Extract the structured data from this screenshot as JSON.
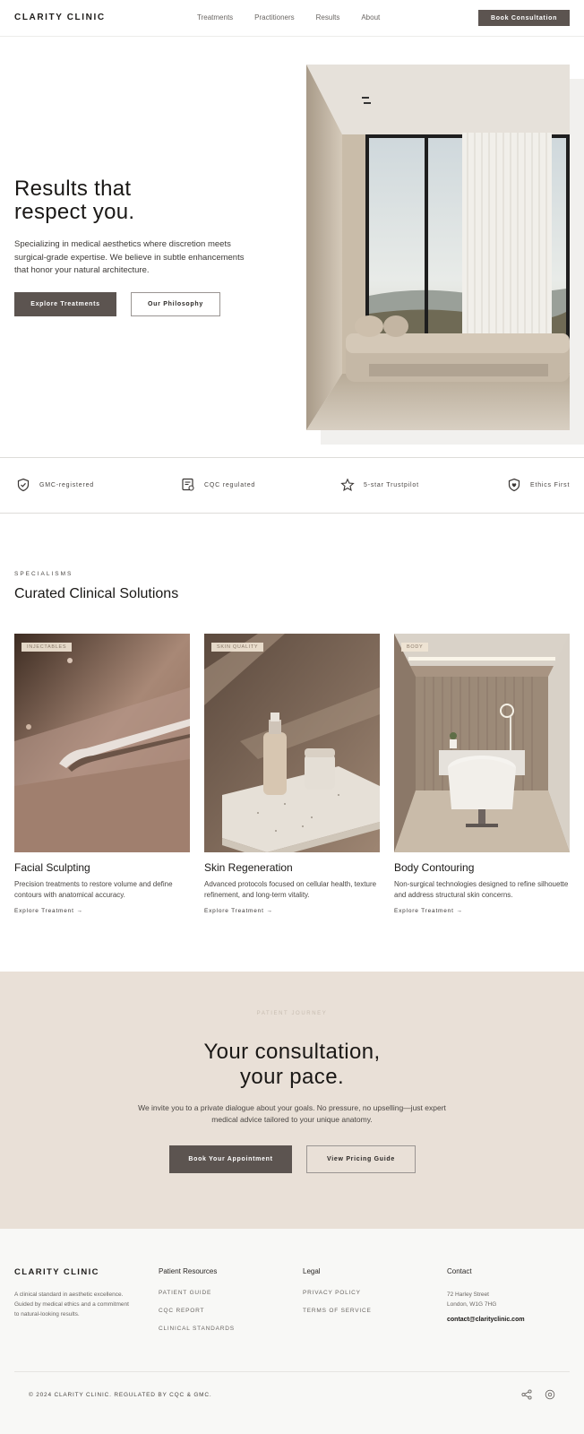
{
  "header": {
    "logo": "CLARITY CLINIC",
    "nav": [
      "Treatments",
      "Practitioners",
      "Results",
      "About"
    ],
    "cta": "Book Consultation"
  },
  "hero": {
    "title_line1": "Results that",
    "title_line2": "respect you.",
    "text": "Specializing in medical aesthetics where discretion meets surgical-grade expertise. We believe in subtle enhancements that honor your natural architecture.",
    "primary_button": "Explore Treatments",
    "secondary_button": "Our Philosophy"
  },
  "trust": {
    "items": [
      {
        "icon": "shield-check-icon",
        "label": "GMC-registered"
      },
      {
        "icon": "certificate-icon",
        "label": "CQC regulated"
      },
      {
        "icon": "star-icon",
        "label": "5-star Trustpilot"
      },
      {
        "icon": "shield-heart-icon",
        "label": "Ethics First"
      }
    ]
  },
  "specialisms": {
    "eyebrow": "SPECIALISMS",
    "title": "Curated Clinical Solutions",
    "cards": [
      {
        "tag": "INJECTABLES",
        "title": "Facial Sculpting",
        "text": "Precision treatments to restore volume and define contours with anatomical accuracy.",
        "link": "Explore Treatment"
      },
      {
        "tag": "SKIN QUALITY",
        "title": "Skin Regeneration",
        "text": "Advanced protocols focused on cellular health, texture refinement, and long-term vitality.",
        "link": "Explore Treatment"
      },
      {
        "tag": "BODY",
        "title": "Body Contouring",
        "text": "Non-surgical technologies designed to refine silhouette and address structural skin concerns.",
        "link": "Explore Treatment"
      }
    ]
  },
  "consultation": {
    "eyebrow": "PATIENT JOURNEY",
    "title_line1": "Your consultation,",
    "title_line2": "your pace.",
    "text": "We invite you to a private dialogue about your goals. No pressure, no upselling—just expert medical advice tailored to your unique anatomy.",
    "primary_button": "Book Your Appointment",
    "secondary_button": "View Pricing Guide"
  },
  "footer": {
    "logo": "CLARITY CLINIC",
    "description": "A clinical standard in aesthetic excellence. Guided by medical ethics and a commitment to natural-looking results.",
    "resources_title": "Patient Resources",
    "resources": [
      "PATIENT GUIDE",
      "CQC REPORT",
      "CLINICAL STANDARDS"
    ],
    "legal_title": "Legal",
    "legal": [
      "PRIVACY POLICY",
      "TERMS OF SERVICE"
    ],
    "contact_title": "Contact",
    "address_line1": "72 Harley Street",
    "address_line2": "London, W1G 7HG",
    "email": "contact@clarityclinic.com",
    "copyright": "© 2024 CLARITY CLINIC. REGULATED BY CQC & GMC."
  },
  "colors": {
    "accent": "#5c5450",
    "consult_bg": "#e9e0d7",
    "footer_bg": "#f8f8f6"
  }
}
